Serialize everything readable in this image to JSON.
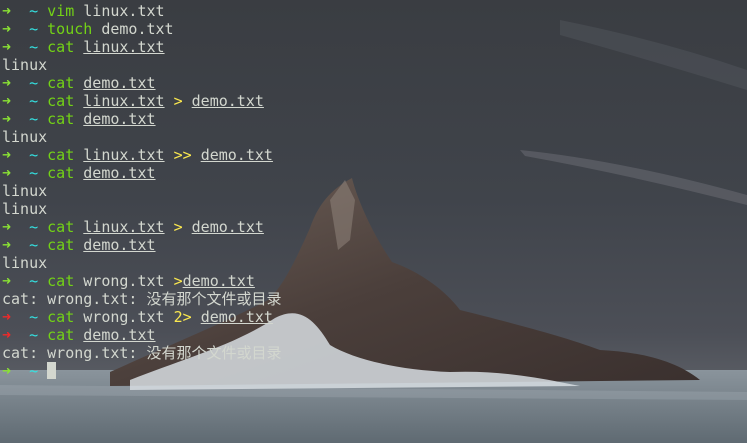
{
  "terminal": {
    "lines": [
      {
        "kind": "prompt",
        "status": "ok",
        "parts": [
          {
            "t": "cmd",
            "v": "vim"
          },
          {
            "t": "text",
            "v": " linux.txt"
          }
        ]
      },
      {
        "kind": "prompt",
        "status": "ok",
        "parts": [
          {
            "t": "cmd",
            "v": "touch"
          },
          {
            "t": "text",
            "v": " demo.txt"
          }
        ]
      },
      {
        "kind": "prompt",
        "status": "ok",
        "parts": [
          {
            "t": "cmd",
            "v": "cat"
          },
          {
            "t": "text",
            "v": " "
          },
          {
            "t": "file",
            "v": "linux.txt"
          }
        ]
      },
      {
        "kind": "output",
        "text": "linux"
      },
      {
        "kind": "prompt",
        "status": "ok",
        "parts": [
          {
            "t": "cmd",
            "v": "cat"
          },
          {
            "t": "text",
            "v": " "
          },
          {
            "t": "file",
            "v": "demo.txt"
          }
        ]
      },
      {
        "kind": "prompt",
        "status": "ok",
        "parts": [
          {
            "t": "cmd",
            "v": "cat"
          },
          {
            "t": "text",
            "v": " "
          },
          {
            "t": "file",
            "v": "linux.txt"
          },
          {
            "t": "text",
            "v": " "
          },
          {
            "t": "op",
            "v": ">"
          },
          {
            "t": "text",
            "v": " "
          },
          {
            "t": "file",
            "v": "demo.txt"
          }
        ]
      },
      {
        "kind": "prompt",
        "status": "ok",
        "parts": [
          {
            "t": "cmd",
            "v": "cat"
          },
          {
            "t": "text",
            "v": " "
          },
          {
            "t": "file",
            "v": "demo.txt"
          }
        ]
      },
      {
        "kind": "output",
        "text": "linux"
      },
      {
        "kind": "prompt",
        "status": "ok",
        "parts": [
          {
            "t": "cmd",
            "v": "cat"
          },
          {
            "t": "text",
            "v": " "
          },
          {
            "t": "file",
            "v": "linux.txt"
          },
          {
            "t": "text",
            "v": " "
          },
          {
            "t": "op",
            "v": ">>"
          },
          {
            "t": "text",
            "v": " "
          },
          {
            "t": "file",
            "v": "demo.txt"
          }
        ]
      },
      {
        "kind": "prompt",
        "status": "ok",
        "parts": [
          {
            "t": "cmd",
            "v": "cat"
          },
          {
            "t": "text",
            "v": " "
          },
          {
            "t": "file",
            "v": "demo.txt"
          }
        ]
      },
      {
        "kind": "output",
        "text": "linux"
      },
      {
        "kind": "output",
        "text": "linux"
      },
      {
        "kind": "prompt",
        "status": "ok",
        "parts": [
          {
            "t": "cmd",
            "v": "cat"
          },
          {
            "t": "text",
            "v": " "
          },
          {
            "t": "file",
            "v": "linux.txt"
          },
          {
            "t": "text",
            "v": " "
          },
          {
            "t": "op",
            "v": ">"
          },
          {
            "t": "text",
            "v": " "
          },
          {
            "t": "file",
            "v": "demo.txt"
          }
        ]
      },
      {
        "kind": "prompt",
        "status": "ok",
        "parts": [
          {
            "t": "cmd",
            "v": "cat"
          },
          {
            "t": "text",
            "v": " "
          },
          {
            "t": "file",
            "v": "demo.txt"
          }
        ]
      },
      {
        "kind": "output",
        "text": "linux"
      },
      {
        "kind": "prompt",
        "status": "ok",
        "parts": [
          {
            "t": "cmd",
            "v": "cat"
          },
          {
            "t": "text",
            "v": " wrong.txt "
          },
          {
            "t": "op",
            "v": ">"
          },
          {
            "t": "file",
            "v": "demo.txt"
          }
        ]
      },
      {
        "kind": "output",
        "text": "cat: wrong.txt: 没有那个文件或目录"
      },
      {
        "kind": "prompt",
        "status": "err",
        "parts": [
          {
            "t": "cmd",
            "v": "cat"
          },
          {
            "t": "text",
            "v": " wrong.txt "
          },
          {
            "t": "op",
            "v": "2>"
          },
          {
            "t": "text",
            "v": " "
          },
          {
            "t": "file",
            "v": "demo.txt"
          }
        ]
      },
      {
        "kind": "prompt",
        "status": "err",
        "parts": [
          {
            "t": "cmd",
            "v": "cat"
          },
          {
            "t": "text",
            "v": " "
          },
          {
            "t": "file",
            "v": "demo.txt"
          }
        ]
      },
      {
        "kind": "output",
        "text": "cat: wrong.txt: 没有那个文件或目录"
      },
      {
        "kind": "prompt",
        "status": "ok",
        "parts": [],
        "cursor": true
      }
    ],
    "prompt_arrow": "➜",
    "prompt_dir": "~",
    "colors": {
      "arrow_ok": "#8ae234",
      "arrow_err": "#ef2929",
      "dir": "#34e2e2",
      "command": "#73d216",
      "operator": "#fce94f",
      "text": "#d3d7cf"
    }
  }
}
